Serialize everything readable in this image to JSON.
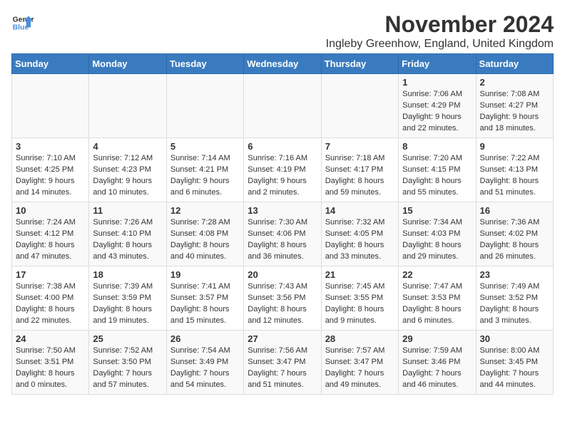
{
  "header": {
    "logo_line1": "General",
    "logo_line2": "Blue",
    "month_title": "November 2024",
    "location": "Ingleby Greenhow, England, United Kingdom"
  },
  "weekdays": [
    "Sunday",
    "Monday",
    "Tuesday",
    "Wednesday",
    "Thursday",
    "Friday",
    "Saturday"
  ],
  "weeks": [
    [
      {
        "day": "",
        "sunrise": "",
        "sunset": "",
        "daylight": ""
      },
      {
        "day": "",
        "sunrise": "",
        "sunset": "",
        "daylight": ""
      },
      {
        "day": "",
        "sunrise": "",
        "sunset": "",
        "daylight": ""
      },
      {
        "day": "",
        "sunrise": "",
        "sunset": "",
        "daylight": ""
      },
      {
        "day": "",
        "sunrise": "",
        "sunset": "",
        "daylight": ""
      },
      {
        "day": "1",
        "sunrise": "Sunrise: 7:06 AM",
        "sunset": "Sunset: 4:29 PM",
        "daylight": "Daylight: 9 hours and 22 minutes."
      },
      {
        "day": "2",
        "sunrise": "Sunrise: 7:08 AM",
        "sunset": "Sunset: 4:27 PM",
        "daylight": "Daylight: 9 hours and 18 minutes."
      }
    ],
    [
      {
        "day": "3",
        "sunrise": "Sunrise: 7:10 AM",
        "sunset": "Sunset: 4:25 PM",
        "daylight": "Daylight: 9 hours and 14 minutes."
      },
      {
        "day": "4",
        "sunrise": "Sunrise: 7:12 AM",
        "sunset": "Sunset: 4:23 PM",
        "daylight": "Daylight: 9 hours and 10 minutes."
      },
      {
        "day": "5",
        "sunrise": "Sunrise: 7:14 AM",
        "sunset": "Sunset: 4:21 PM",
        "daylight": "Daylight: 9 hours and 6 minutes."
      },
      {
        "day": "6",
        "sunrise": "Sunrise: 7:16 AM",
        "sunset": "Sunset: 4:19 PM",
        "daylight": "Daylight: 9 hours and 2 minutes."
      },
      {
        "day": "7",
        "sunrise": "Sunrise: 7:18 AM",
        "sunset": "Sunset: 4:17 PM",
        "daylight": "Daylight: 8 hours and 59 minutes."
      },
      {
        "day": "8",
        "sunrise": "Sunrise: 7:20 AM",
        "sunset": "Sunset: 4:15 PM",
        "daylight": "Daylight: 8 hours and 55 minutes."
      },
      {
        "day": "9",
        "sunrise": "Sunrise: 7:22 AM",
        "sunset": "Sunset: 4:13 PM",
        "daylight": "Daylight: 8 hours and 51 minutes."
      }
    ],
    [
      {
        "day": "10",
        "sunrise": "Sunrise: 7:24 AM",
        "sunset": "Sunset: 4:12 PM",
        "daylight": "Daylight: 8 hours and 47 minutes."
      },
      {
        "day": "11",
        "sunrise": "Sunrise: 7:26 AM",
        "sunset": "Sunset: 4:10 PM",
        "daylight": "Daylight: 8 hours and 43 minutes."
      },
      {
        "day": "12",
        "sunrise": "Sunrise: 7:28 AM",
        "sunset": "Sunset: 4:08 PM",
        "daylight": "Daylight: 8 hours and 40 minutes."
      },
      {
        "day": "13",
        "sunrise": "Sunrise: 7:30 AM",
        "sunset": "Sunset: 4:06 PM",
        "daylight": "Daylight: 8 hours and 36 minutes."
      },
      {
        "day": "14",
        "sunrise": "Sunrise: 7:32 AM",
        "sunset": "Sunset: 4:05 PM",
        "daylight": "Daylight: 8 hours and 33 minutes."
      },
      {
        "day": "15",
        "sunrise": "Sunrise: 7:34 AM",
        "sunset": "Sunset: 4:03 PM",
        "daylight": "Daylight: 8 hours and 29 minutes."
      },
      {
        "day": "16",
        "sunrise": "Sunrise: 7:36 AM",
        "sunset": "Sunset: 4:02 PM",
        "daylight": "Daylight: 8 hours and 26 minutes."
      }
    ],
    [
      {
        "day": "17",
        "sunrise": "Sunrise: 7:38 AM",
        "sunset": "Sunset: 4:00 PM",
        "daylight": "Daylight: 8 hours and 22 minutes."
      },
      {
        "day": "18",
        "sunrise": "Sunrise: 7:39 AM",
        "sunset": "Sunset: 3:59 PM",
        "daylight": "Daylight: 8 hours and 19 minutes."
      },
      {
        "day": "19",
        "sunrise": "Sunrise: 7:41 AM",
        "sunset": "Sunset: 3:57 PM",
        "daylight": "Daylight: 8 hours and 15 minutes."
      },
      {
        "day": "20",
        "sunrise": "Sunrise: 7:43 AM",
        "sunset": "Sunset: 3:56 PM",
        "daylight": "Daylight: 8 hours and 12 minutes."
      },
      {
        "day": "21",
        "sunrise": "Sunrise: 7:45 AM",
        "sunset": "Sunset: 3:55 PM",
        "daylight": "Daylight: 8 hours and 9 minutes."
      },
      {
        "day": "22",
        "sunrise": "Sunrise: 7:47 AM",
        "sunset": "Sunset: 3:53 PM",
        "daylight": "Daylight: 8 hours and 6 minutes."
      },
      {
        "day": "23",
        "sunrise": "Sunrise: 7:49 AM",
        "sunset": "Sunset: 3:52 PM",
        "daylight": "Daylight: 8 hours and 3 minutes."
      }
    ],
    [
      {
        "day": "24",
        "sunrise": "Sunrise: 7:50 AM",
        "sunset": "Sunset: 3:51 PM",
        "daylight": "Daylight: 8 hours and 0 minutes."
      },
      {
        "day": "25",
        "sunrise": "Sunrise: 7:52 AM",
        "sunset": "Sunset: 3:50 PM",
        "daylight": "Daylight: 7 hours and 57 minutes."
      },
      {
        "day": "26",
        "sunrise": "Sunrise: 7:54 AM",
        "sunset": "Sunset: 3:49 PM",
        "daylight": "Daylight: 7 hours and 54 minutes."
      },
      {
        "day": "27",
        "sunrise": "Sunrise: 7:56 AM",
        "sunset": "Sunset: 3:47 PM",
        "daylight": "Daylight: 7 hours and 51 minutes."
      },
      {
        "day": "28",
        "sunrise": "Sunrise: 7:57 AM",
        "sunset": "Sunset: 3:47 PM",
        "daylight": "Daylight: 7 hours and 49 minutes."
      },
      {
        "day": "29",
        "sunrise": "Sunrise: 7:59 AM",
        "sunset": "Sunset: 3:46 PM",
        "daylight": "Daylight: 7 hours and 46 minutes."
      },
      {
        "day": "30",
        "sunrise": "Sunrise: 8:00 AM",
        "sunset": "Sunset: 3:45 PM",
        "daylight": "Daylight: 7 hours and 44 minutes."
      }
    ]
  ]
}
